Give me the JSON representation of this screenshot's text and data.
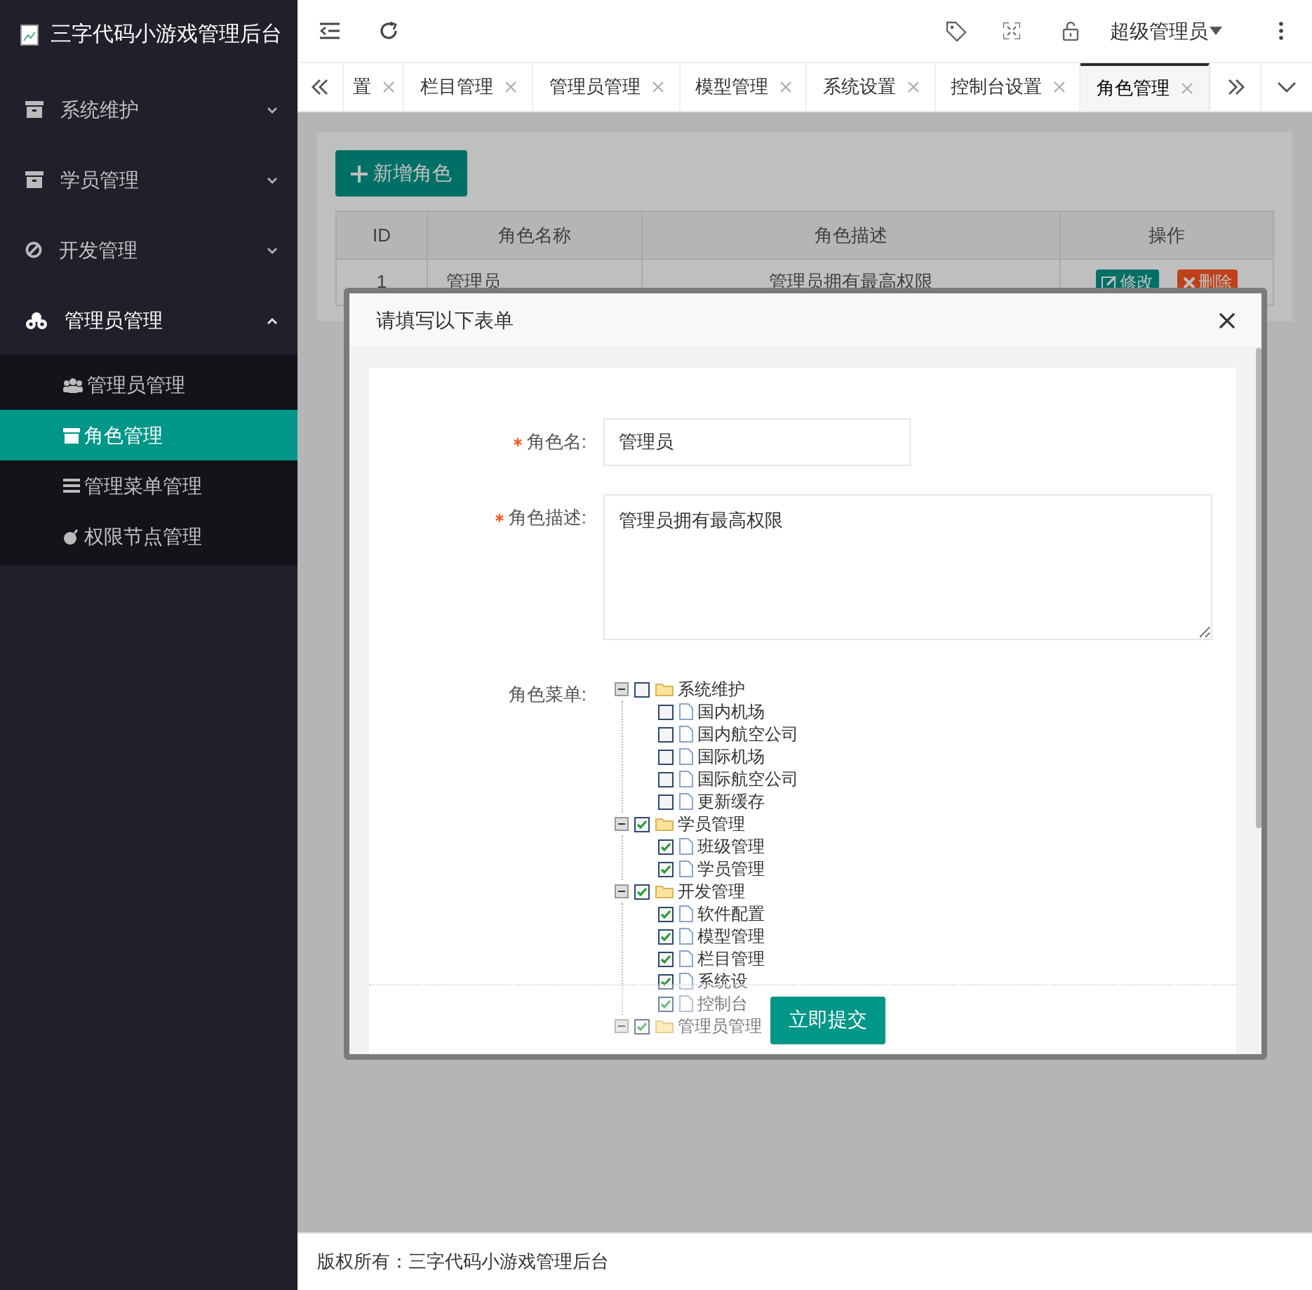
{
  "app_title": "三字代码小游戏管理后台",
  "sidebar": {
    "items": [
      {
        "label": "系统维护",
        "expanded": false
      },
      {
        "label": "学员管理",
        "expanded": false
      },
      {
        "label": "开发管理",
        "expanded": false
      },
      {
        "label": "管理员管理",
        "expanded": true,
        "children": [
          {
            "label": "管理员管理",
            "selected": false
          },
          {
            "label": "角色管理",
            "selected": true
          },
          {
            "label": "管理菜单管理",
            "selected": false
          },
          {
            "label": "权限节点管理",
            "selected": false
          }
        ]
      }
    ]
  },
  "header": {
    "user": "超级管理员"
  },
  "tabs": [
    {
      "label": "置",
      "selected": false
    },
    {
      "label": "栏目管理",
      "selected": false
    },
    {
      "label": "管理员管理",
      "selected": false
    },
    {
      "label": "模型管理",
      "selected": false
    },
    {
      "label": "系统设置",
      "selected": false
    },
    {
      "label": "控制台设置",
      "selected": false
    },
    {
      "label": "角色管理",
      "selected": true
    }
  ],
  "page": {
    "add_button": "新增角色",
    "table": {
      "columns": [
        "ID",
        "角色名称",
        "角色描述",
        "操作"
      ],
      "rows": [
        {
          "id": "1",
          "name": "管理员",
          "description": "管理员拥有最高权限",
          "actions": [
            "修改",
            "删除"
          ]
        }
      ]
    }
  },
  "dialog": {
    "title": "请填写以下表单",
    "fields": [
      {
        "kind": "input",
        "label": "角色名:",
        "required": true,
        "value": "管理员"
      },
      {
        "kind": "textarea",
        "label": "角色描述:",
        "required": true,
        "value": "管理员拥有最高权限"
      },
      {
        "kind": "tree",
        "label": "角色菜单:",
        "required": false
      }
    ],
    "tree": [
      {
        "label": "系统维护",
        "checked": false,
        "expanded": true,
        "children": [
          {
            "label": "国内机场",
            "checked": false
          },
          {
            "label": "国内航空公司",
            "checked": false
          },
          {
            "label": "国际机场",
            "checked": false
          },
          {
            "label": "国际航空公司",
            "checked": false
          },
          {
            "label": "更新缓存",
            "checked": false
          }
        ]
      },
      {
        "label": "学员管理",
        "checked": true,
        "expanded": true,
        "children": [
          {
            "label": "班级管理",
            "checked": true
          },
          {
            "label": "学员管理",
            "checked": true
          }
        ]
      },
      {
        "label": "开发管理",
        "checked": true,
        "expanded": true,
        "children": [
          {
            "label": "软件配置",
            "checked": true
          },
          {
            "label": "模型管理",
            "checked": true
          },
          {
            "label": "栏目管理",
            "checked": true
          },
          {
            "label": "系统设",
            "checked": true
          },
          {
            "label": "控制台",
            "checked": true
          }
        ]
      },
      {
        "label": "管理员管理",
        "checked": true,
        "expanded": true
      }
    ],
    "submit": "立即提交"
  },
  "footer": "版权所有：三字代码小游戏管理后台"
}
